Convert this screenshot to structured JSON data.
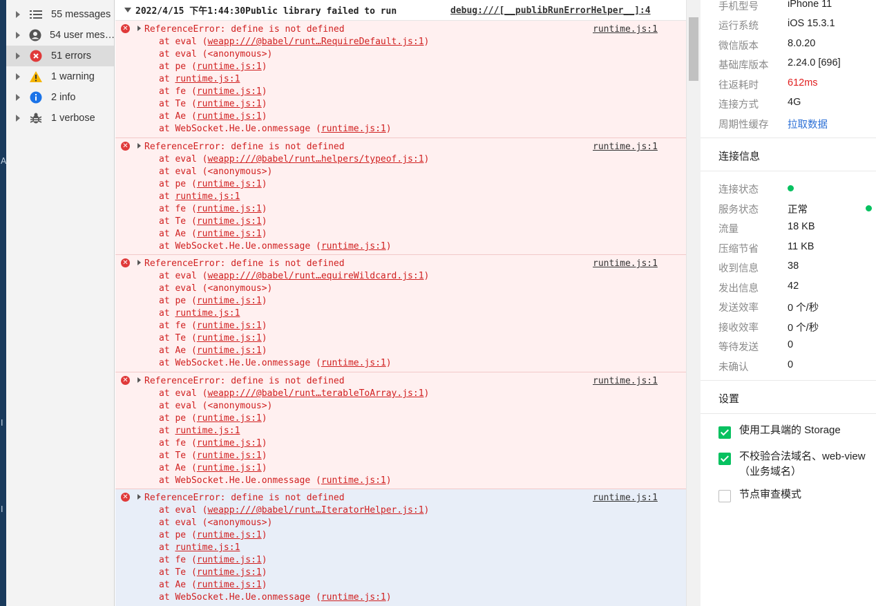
{
  "sidebar": {
    "items": [
      {
        "label": "55 messages",
        "icon": "list-icon"
      },
      {
        "label": "54 user mes…",
        "icon": "user-icon"
      },
      {
        "label": "51 errors",
        "icon": "error-icon"
      },
      {
        "label": "1 warning",
        "icon": "warning-icon"
      },
      {
        "label": "2 info",
        "icon": "info-icon"
      },
      {
        "label": "1 verbose",
        "icon": "bug-icon"
      }
    ],
    "selected_index": 2
  },
  "console": {
    "group_header": "2022/4/15 下午1:44:30Public library failed to run",
    "group_source": "debug:///[__publibRunErrorHelper__]:4",
    "entries": [
      {
        "message": "ReferenceError: define is not defined",
        "source": "runtime.js:1",
        "first_frame": "weapp:///@babel/runt…RequireDefault.js:1"
      },
      {
        "message": "ReferenceError: define is not defined",
        "source": "runtime.js:1",
        "first_frame": "weapp:///@babel/runt…helpers/typeof.js:1"
      },
      {
        "message": "ReferenceError: define is not defined",
        "source": "runtime.js:1",
        "first_frame": "weapp:///@babel/runt…equireWildcard.js:1"
      },
      {
        "message": "ReferenceError: define is not defined",
        "source": "runtime.js:1",
        "first_frame": "weapp:///@babel/runt…terableToArray.js:1"
      },
      {
        "message": "ReferenceError: define is not defined",
        "source": "runtime.js:1",
        "first_frame": "weapp:///@babel/runt…IteratorHelper.js:1"
      }
    ],
    "stack": {
      "at": "at",
      "eval": "eval",
      "anonymous": "(<anonymous>)",
      "pe": "pe",
      "fe": "fe",
      "Te": "Te",
      "Ae": "Ae",
      "ws": "WebSocket.He.Ue.onmessage",
      "runtime": "runtime.js:1"
    }
  },
  "device": [
    {
      "key": "手机型号",
      "value": "iPhone 11"
    },
    {
      "key": "运行系统",
      "value": "iOS 15.3.1"
    },
    {
      "key": "微信版本",
      "value": "8.0.20"
    },
    {
      "key": "基础库版本",
      "value": "2.24.0 [696]"
    },
    {
      "key": "往返耗时",
      "value": "612ms"
    },
    {
      "key": "连接方式",
      "value": "4G"
    },
    {
      "key": "周期性缓存",
      "value": "拉取数据"
    }
  ],
  "connection": {
    "title": "连接信息",
    "rows": [
      {
        "key": "连接状态",
        "value": ""
      },
      {
        "key": "服务状态",
        "value": "正常"
      },
      {
        "key": "流量",
        "value": "18 KB"
      },
      {
        "key": "压缩节省",
        "value": "11 KB"
      },
      {
        "key": "收到信息",
        "value": "38"
      },
      {
        "key": "发出信息",
        "value": "42"
      },
      {
        "key": "发送效率",
        "value": "0 个/秒"
      },
      {
        "key": "接收效率",
        "value": "0 个/秒"
      },
      {
        "key": "等待发送",
        "value": "0"
      },
      {
        "key": "未确认",
        "value": "0"
      }
    ]
  },
  "settings": {
    "title": "设置",
    "options": [
      {
        "label": "使用工具端的 Storage",
        "checked": true
      },
      {
        "label": "不校验合法域名、web-view（业务域名）",
        "checked": true
      },
      {
        "label": "节点审查模式",
        "checked": false
      }
    ]
  },
  "colors": {
    "error_red": "#d01f1f",
    "latency_red": "#e02020",
    "link_blue": "#2b6fd6",
    "status_green": "#07c160",
    "warning_yellow": "#f5b400",
    "info_blue": "#1a73e8"
  }
}
